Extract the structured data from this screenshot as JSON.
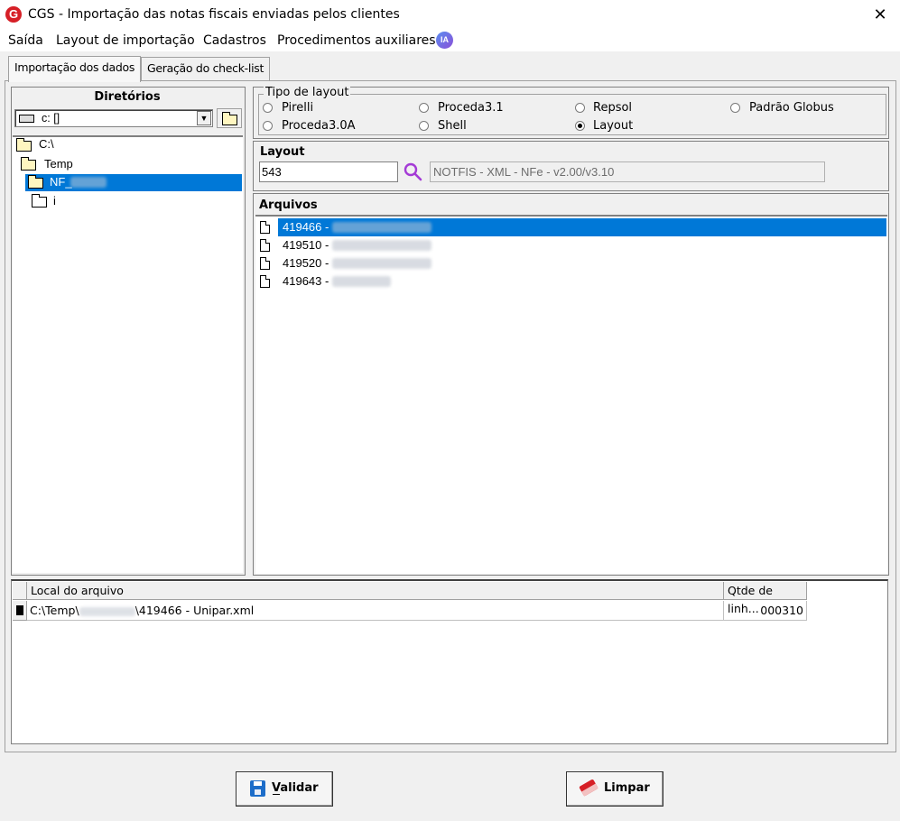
{
  "window": {
    "title": "CGS - Importação das notas fiscais enviadas pelos clientes",
    "close": "✕",
    "logo": "G"
  },
  "menu": {
    "items": [
      "Saída",
      "Layout de importação",
      "Cadastros",
      "Procedimentos auxiliares"
    ],
    "ia_badge": "IA"
  },
  "tabs": [
    "Importação dos dados",
    "Geração do check-list"
  ],
  "directories": {
    "title": "Diretórios",
    "drive": "c: []",
    "tree": [
      "C:\\",
      "Temp",
      "NF_",
      "i"
    ]
  },
  "layout_type": {
    "group_label": "Tipo de layout",
    "options": [
      "Pirelli",
      "Proceda3.1",
      "Repsol",
      "Padrão Globus",
      "Proceda3.0A",
      "Shell",
      "Layout"
    ],
    "selected": "Layout"
  },
  "layout": {
    "label": "Layout",
    "code": "543",
    "description": "NOTFIS - XML - NFe - v2.00/v3.10"
  },
  "files": {
    "label": "Arquivos",
    "items": [
      "419466 -",
      "419510 -",
      "419520 -",
      "419643 -"
    ],
    "selected_index": 0
  },
  "file_table": {
    "columns": [
      "Local do arquivo",
      "Qtde de linh..."
    ],
    "rows": [
      {
        "path_prefix": "C:\\Temp\\",
        "path_suffix": "\\419466 - Unipar.xml",
        "lines": "000310"
      }
    ]
  },
  "buttons": {
    "validate": "Validar",
    "clear": "Limpar"
  },
  "colors": {
    "selection": "#0078d7",
    "accent_logo": "#d61f26"
  }
}
